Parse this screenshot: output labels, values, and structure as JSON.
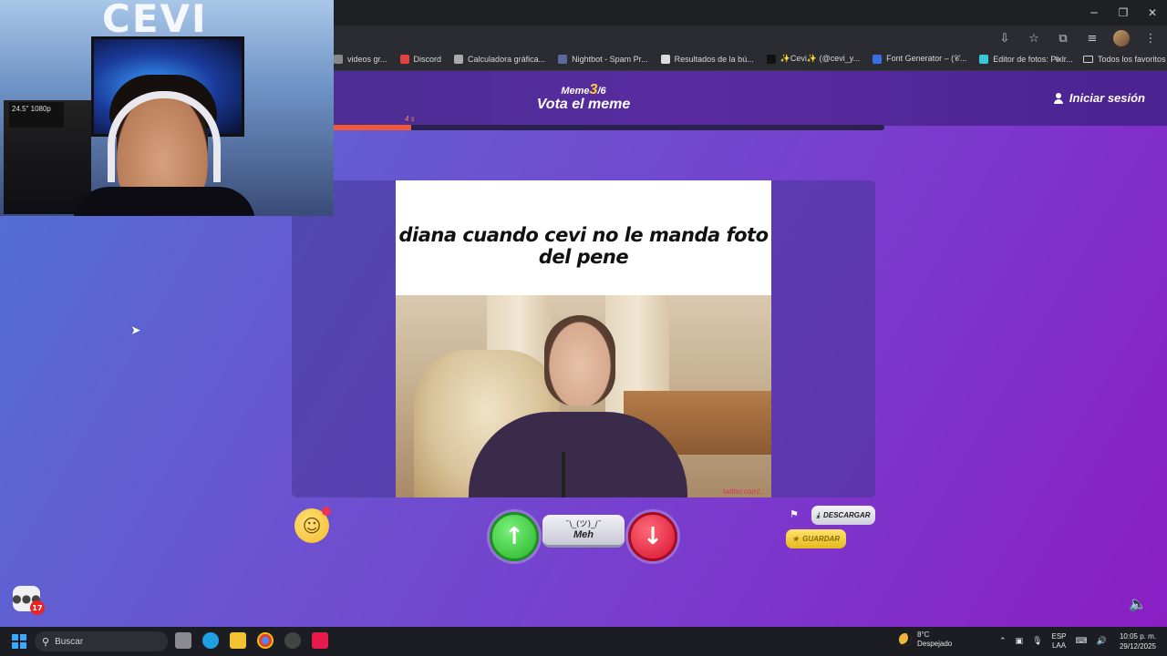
{
  "browser": {
    "bookmarks": [
      {
        "label": "videos gr...",
        "color": "#888888"
      },
      {
        "label": "Discord",
        "color": "#e34040"
      },
      {
        "label": "Calculadora gráfica...",
        "color": "#aaaaaa"
      },
      {
        "label": "Nightbot - Spam Pr...",
        "color": "#5a6a9a"
      },
      {
        "label": "Resultados de la bú...",
        "color": "#dddddd"
      },
      {
        "label": "✨Cevi✨ (@cevi_y...",
        "color": "#111111"
      },
      {
        "label": "Font Generator – (𝒞...",
        "color": "#3a6ee8"
      },
      {
        "label": "Editor de fotos: Pixlr...",
        "color": "#3ac8d8"
      }
    ],
    "bookmarks_overflow": "»",
    "all_favorites": "Todos los favoritos"
  },
  "header": {
    "meme_word": "Meme",
    "meme_current": "3",
    "meme_total": "/6",
    "title": "Vota el meme",
    "login_label": "Iniciar sesión",
    "timer_label": "4 s",
    "progress_fraction": 0.14
  },
  "meme": {
    "caption": "diana cuando cevi no le manda foto del pene",
    "watermark": "twitter.com/..."
  },
  "controls": {
    "upvote_icon": "arrow-up-icon",
    "downvote_icon": "arrow-down-icon",
    "meh_face": "¯\\_(ツ)_/¯",
    "meh_label": "Meh",
    "download_label": "DESCARGAR",
    "save_label": "GUARDAR",
    "chat_badge": "17"
  },
  "webcam": {
    "logo_text": "CEVI",
    "box_text": "24.5\" 1080p"
  },
  "taskbar": {
    "search_label": "Buscar",
    "weather_temp": "8°C",
    "weather_desc": "Despejado",
    "lang_top": "ESP",
    "lang_bottom": "LAA",
    "time": "10:05 p. m.",
    "date": "29/12/2025"
  }
}
